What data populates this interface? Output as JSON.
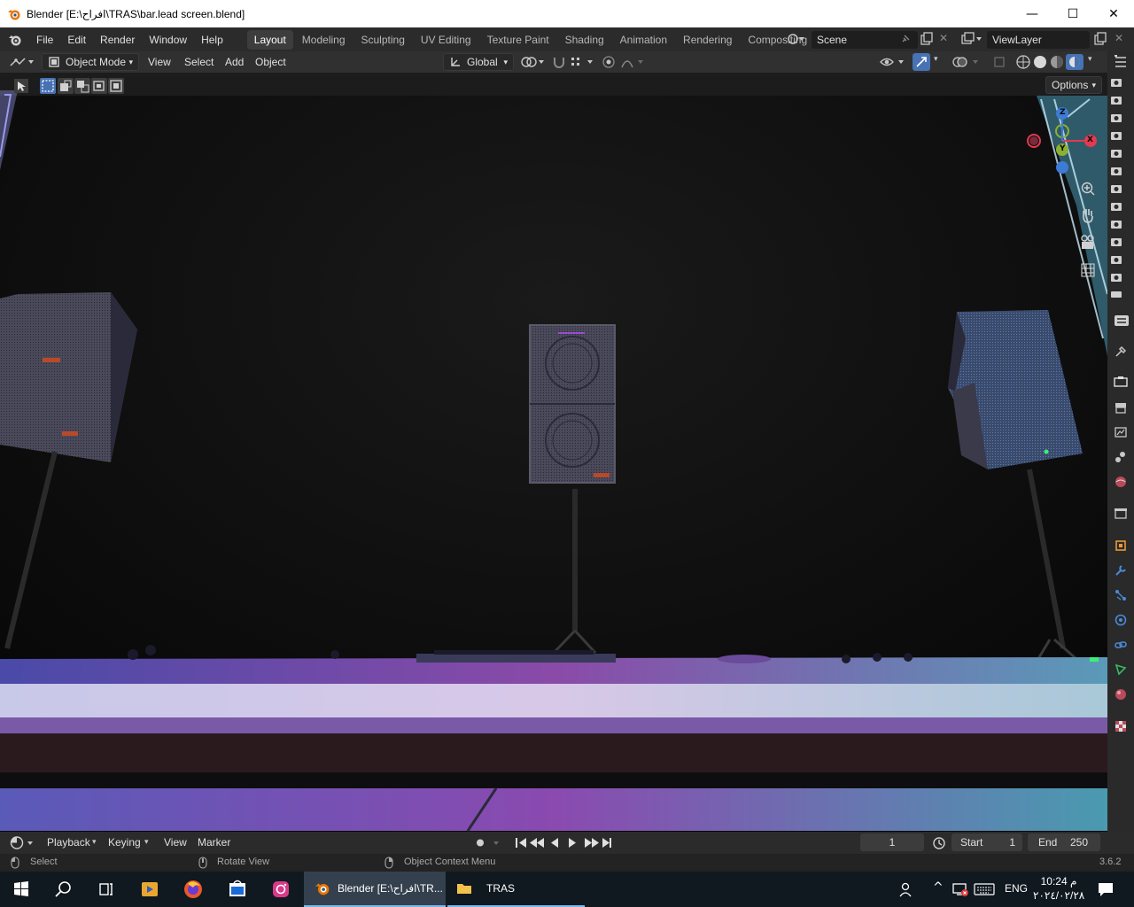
{
  "window": {
    "title": "Blender [E:\\افراح\\TRAS\\bar.lead screen.blend]",
    "controls": {
      "minimize": "—",
      "maximize": "☐",
      "close": "✕"
    }
  },
  "topbar": {
    "menus": [
      "File",
      "Edit",
      "Render",
      "Window",
      "Help"
    ],
    "workspaces": [
      "Layout",
      "Modeling",
      "Sculpting",
      "UV Editing",
      "Texture Paint",
      "Shading",
      "Animation",
      "Rendering",
      "Compositing"
    ],
    "active_workspace": "Layout",
    "scene": "Scene",
    "view_layer": "ViewLayer"
  },
  "viewport_header": {
    "mode": "Object Mode",
    "menus": [
      "View",
      "Select",
      "Add",
      "Object"
    ],
    "transform_orientation": "Global",
    "options_label": "Options"
  },
  "timeline": {
    "menus": [
      "Playback",
      "Keying",
      "View",
      "Marker"
    ],
    "current_frame": "1",
    "start_label": "Start",
    "start_value": "1",
    "end_label": "End",
    "end_value": "250"
  },
  "statusbar": {
    "select": "Select",
    "rotate_view": "Rotate View",
    "context_menu": "Object Context Menu",
    "version": "3.6.2"
  },
  "taskbar": {
    "blender_app": "Blender [E:\\افراح\\TR...",
    "folder_app": "TRAS",
    "language": "ENG",
    "time": "10:24 م",
    "date": "٢٠٢٤/٠٢/٢٨"
  },
  "colors": {
    "accent": "#4772b3",
    "gizmo_x": "#e23a4f",
    "gizmo_y": "#8bb131",
    "gizmo_z": "#3d7bd6"
  }
}
